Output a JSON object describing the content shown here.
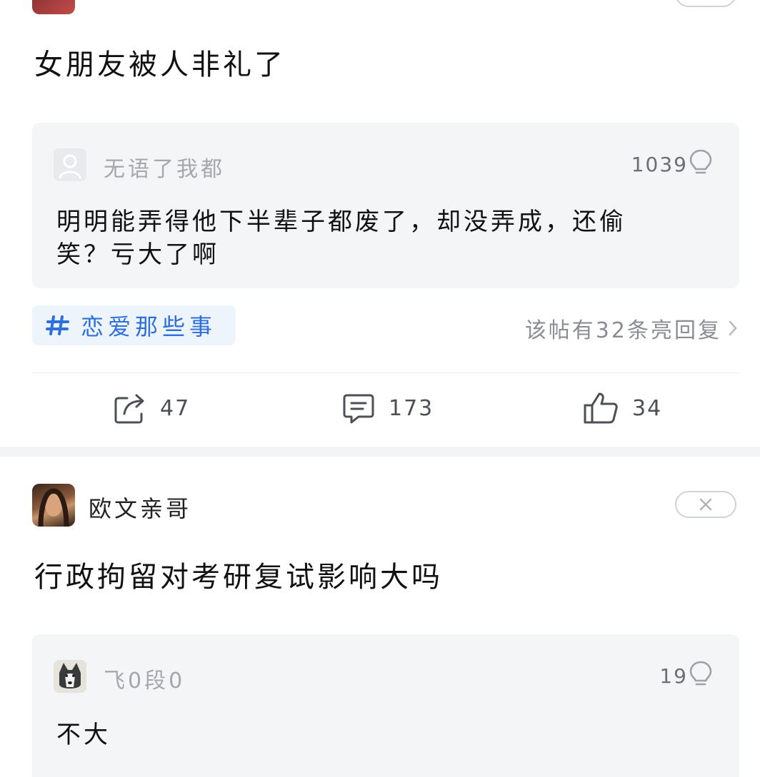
{
  "post1": {
    "title": "女朋友被人非礼了",
    "reply": {
      "username": "无语了我都",
      "likes": "1039",
      "text_line1": "明明能弄得他下半辈子都废了，却没弄成，还偷",
      "text_line2": "笑？亏大了啊"
    },
    "topic_tag": "恋爱那些事",
    "hot_replies_link": "该帖有32条亮回复",
    "actions": {
      "share": "47",
      "comment": "173",
      "like": "34"
    }
  },
  "post2": {
    "username": "欧文亲哥",
    "title": "行政拘留对考研复试影响大吗",
    "reply": {
      "username": "飞0段0",
      "likes": "19",
      "text": "不大"
    }
  },
  "icons": {
    "close": "close-icon",
    "bulb": "lightbulb-icon",
    "share": "share-icon",
    "comment": "comment-icon",
    "like": "thumbs-up-icon",
    "hashtag": "hashtag-icon",
    "chevron": "chevron-right-icon"
  },
  "colors": {
    "accent": "#2f6fdc",
    "tag_bg": "#eef4fc",
    "reply_bg": "#f4f5f7",
    "muted": "#8a8d93"
  }
}
